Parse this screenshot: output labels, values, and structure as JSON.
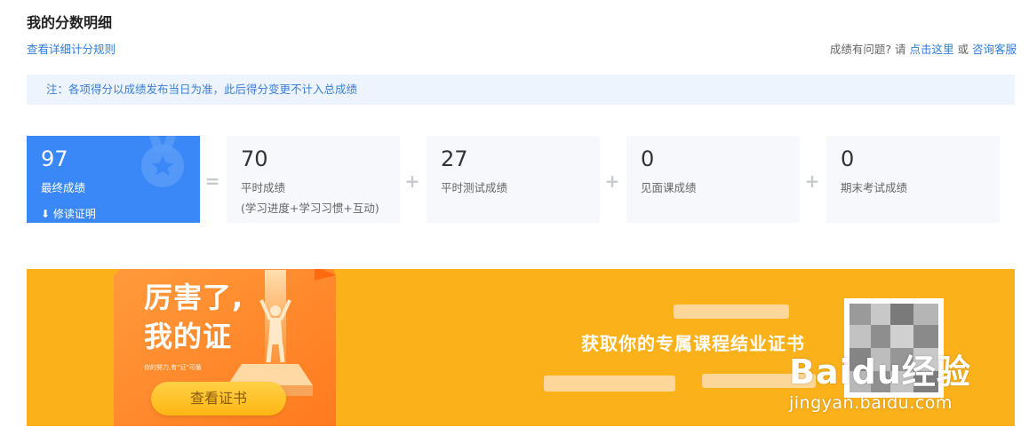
{
  "header": {
    "title": "我的分数明细",
    "rules_link": "查看详细计分规则"
  },
  "help": {
    "question": "成绩有问题?",
    "please": "请",
    "click_here": "点击这里",
    "or": "或",
    "contact": "咨询客服"
  },
  "notice": "注：各项得分以成绩发布当日为准，此后得分变更不计入总成绩",
  "scores": {
    "final": {
      "value": "97",
      "label": "最终成绩",
      "cert_link": "修读证明",
      "cert_icon": "download-arrow-icon"
    },
    "operators": [
      "=",
      "+",
      "+",
      "+"
    ],
    "parts": [
      {
        "value": "70",
        "label": "平时成绩",
        "sub": "(学习进度+学习习惯+互动)"
      },
      {
        "value": "27",
        "label": "平时测试成绩",
        "sub": ""
      },
      {
        "value": "0",
        "label": "见面课成绩",
        "sub": ""
      },
      {
        "value": "0",
        "label": "期末考试成绩",
        "sub": ""
      }
    ]
  },
  "banner": {
    "promo_title_line1": "厉害了,",
    "promo_title_line2": "我的证",
    "promo_small": "你的努力,有\"证\"可循",
    "button": "查看证书",
    "headline": "获取你的专属课程结业证书",
    "background": "#fbb11a"
  },
  "watermark": {
    "brand": "Baidu经验",
    "url": "jingyan.baidu.com"
  },
  "colors": {
    "accent_blue": "#3a88f8",
    "link_blue": "#2d7cdb",
    "notice_bg": "#eef4fd"
  }
}
